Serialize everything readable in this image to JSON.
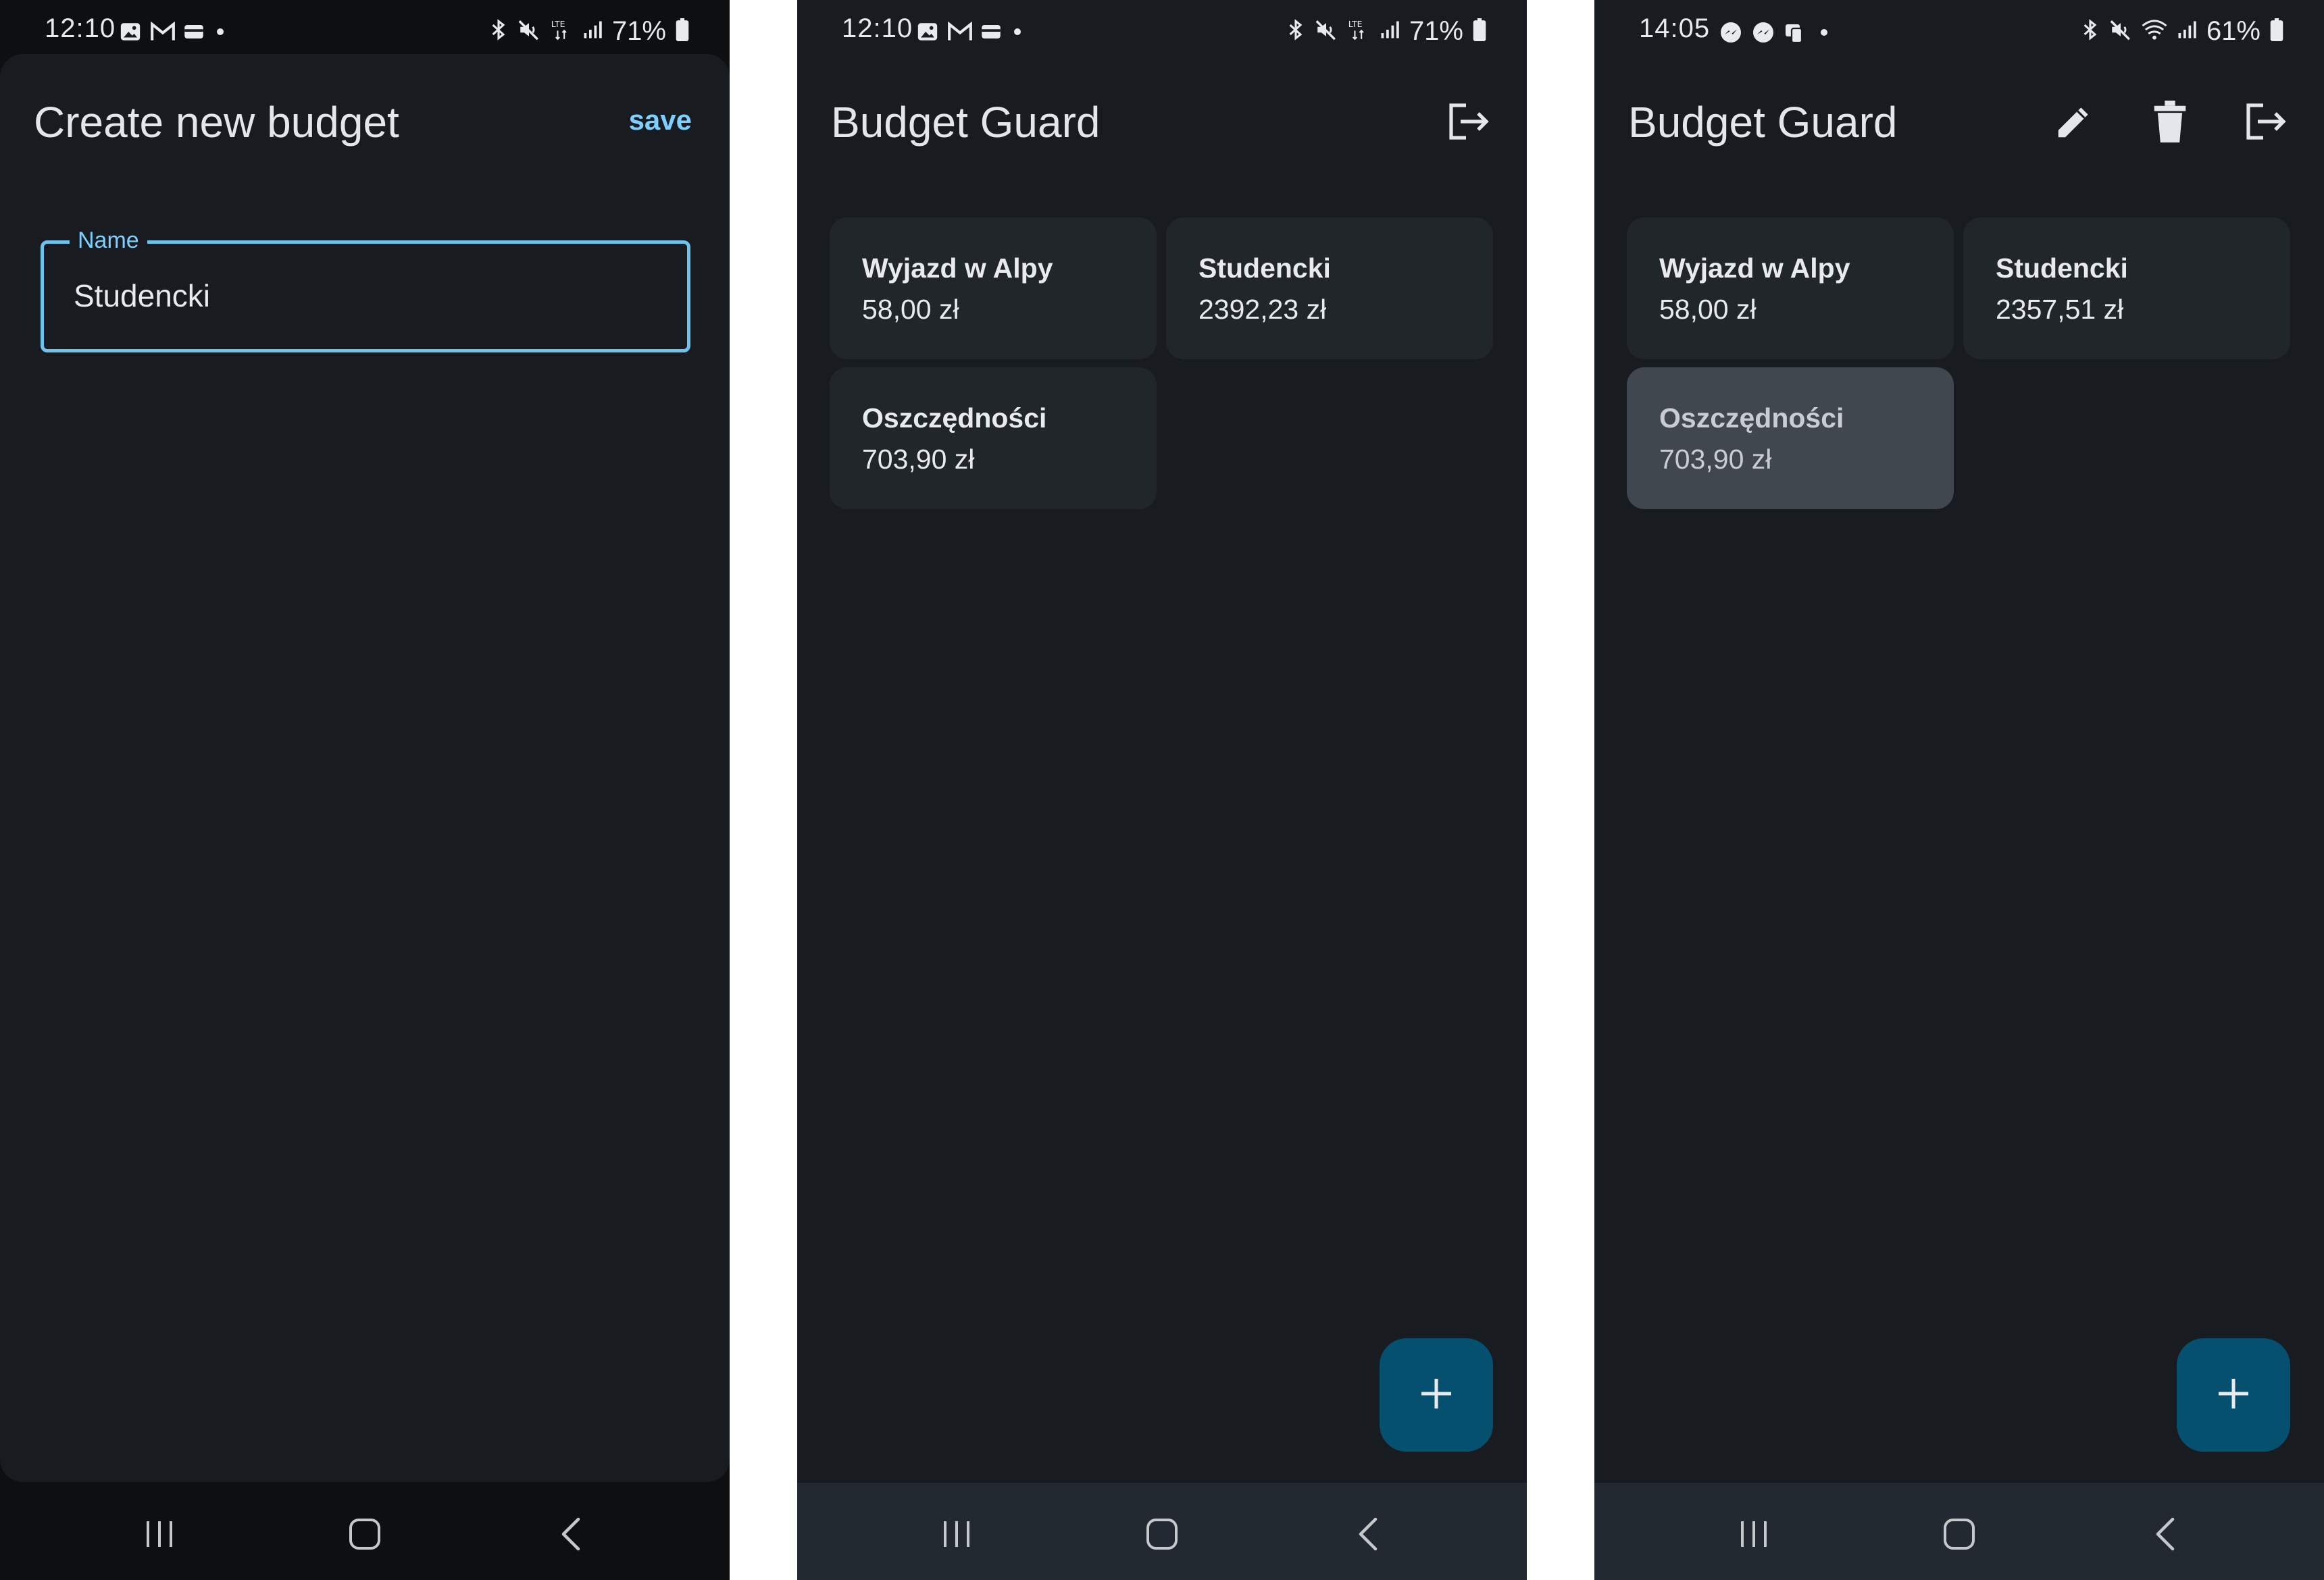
{
  "colors": {
    "background": "#181c20",
    "accent": "#7dcfff",
    "card": "#21262b",
    "card_selected": "#41474e",
    "fab": "#05506e",
    "navbar": "#232930"
  },
  "screens": [
    {
      "status": {
        "time": "12:10",
        "battery": "71%"
      },
      "title": "Create new budget",
      "save_label": "save",
      "name_field": {
        "label": "Name",
        "value": "Studencki"
      },
      "nav_icons": [
        "recent-apps-icon",
        "home-icon",
        "back-icon"
      ]
    },
    {
      "status": {
        "time": "12:10",
        "battery": "71%"
      },
      "title": "Budget Guard",
      "actions": [
        "logout-icon"
      ],
      "budgets": [
        {
          "name": "Wyjazd w Alpy",
          "amount": "58,00 zł"
        },
        {
          "name": "Studencki",
          "amount": "2392,23 zł"
        },
        {
          "name": "Oszczędności",
          "amount": "703,90 zł"
        }
      ],
      "fab_icon": "plus-icon"
    },
    {
      "status": {
        "time": "14:05",
        "battery": "61%"
      },
      "title": "Budget Guard",
      "actions": [
        "edit-icon",
        "delete-icon",
        "logout-icon"
      ],
      "budgets": [
        {
          "name": "Wyjazd w Alpy",
          "amount": "58,00 zł"
        },
        {
          "name": "Studencki",
          "amount": "2357,51 zł"
        },
        {
          "name": "Oszczędności",
          "amount": "703,90 zł",
          "selected": true
        }
      ],
      "fab_icon": "plus-icon"
    }
  ]
}
